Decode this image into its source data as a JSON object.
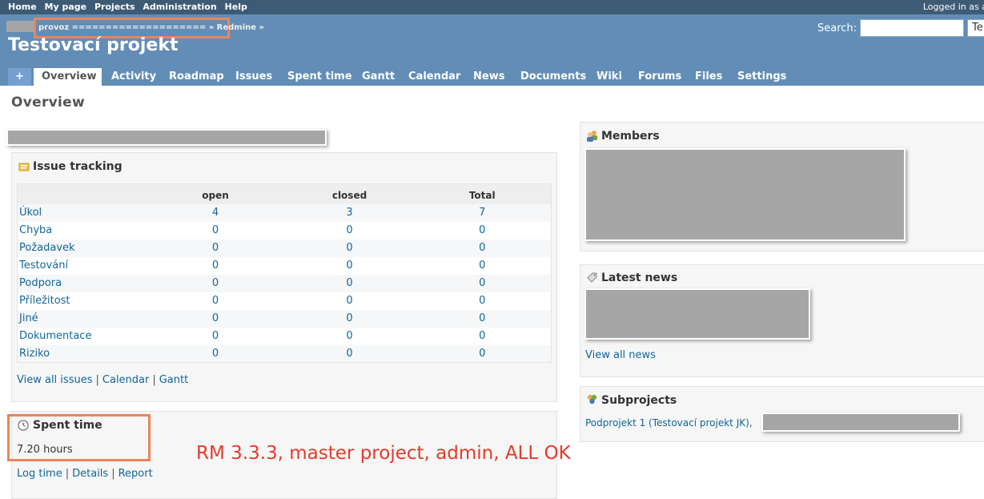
{
  "top_menu": {
    "items": [
      "Home",
      "My page",
      "Projects",
      "Administration",
      "Help"
    ],
    "logged_in": "Logged in as a"
  },
  "header": {
    "breadcrumb": "provoz ==================== » Redmine »",
    "search_label": "Search:",
    "search_value": "",
    "project_select": "Te",
    "project_title": "Testovací projekt"
  },
  "tabs": {
    "plus": "+",
    "items": [
      "Overview",
      "Activity",
      "Roadmap",
      "Issues",
      "Spent time",
      "Gantt",
      "Calendar",
      "News",
      "Documents",
      "Wiki",
      "Forums",
      "Files",
      "Settings"
    ],
    "selected": "Overview"
  },
  "page": {
    "title": "Overview"
  },
  "issue_tracking": {
    "title": "Issue tracking",
    "columns": [
      "",
      "open",
      "closed",
      "Total"
    ],
    "rows": [
      {
        "name": "Úkol",
        "open": "4",
        "closed": "3",
        "total": "7"
      },
      {
        "name": "Chyba",
        "open": "0",
        "closed": "0",
        "total": "0"
      },
      {
        "name": "Požadavek",
        "open": "0",
        "closed": "0",
        "total": "0"
      },
      {
        "name": "Testování",
        "open": "0",
        "closed": "0",
        "total": "0"
      },
      {
        "name": "Podpora",
        "open": "0",
        "closed": "0",
        "total": "0"
      },
      {
        "name": "Příležitost",
        "open": "0",
        "closed": "0",
        "total": "0"
      },
      {
        "name": "Jiné",
        "open": "0",
        "closed": "0",
        "total": "0"
      },
      {
        "name": "Dokumentace",
        "open": "0",
        "closed": "0",
        "total": "0"
      },
      {
        "name": "Riziko",
        "open": "0",
        "closed": "0",
        "total": "0"
      }
    ],
    "links": [
      "View all issues",
      "Calendar",
      "Gantt"
    ]
  },
  "spent_time": {
    "title": "Spent time",
    "hours": "7.20 hours",
    "links": [
      "Log time",
      "Details",
      "Report"
    ]
  },
  "members": {
    "title": "Members"
  },
  "latest_news": {
    "title": "Latest news",
    "view_all": "View all news"
  },
  "subprojects": {
    "title": "Subprojects",
    "item": "Podprojekt 1 (Testovací projekt JK),"
  },
  "annotation": "RM 3.3.3, master project, admin, ALL OK",
  "colors": {
    "top_menu_bg": "#3E5B76",
    "header_bg": "#628DB6",
    "link": "#116699",
    "highlight": "#E8855A",
    "annotation": "#E53A2A"
  }
}
